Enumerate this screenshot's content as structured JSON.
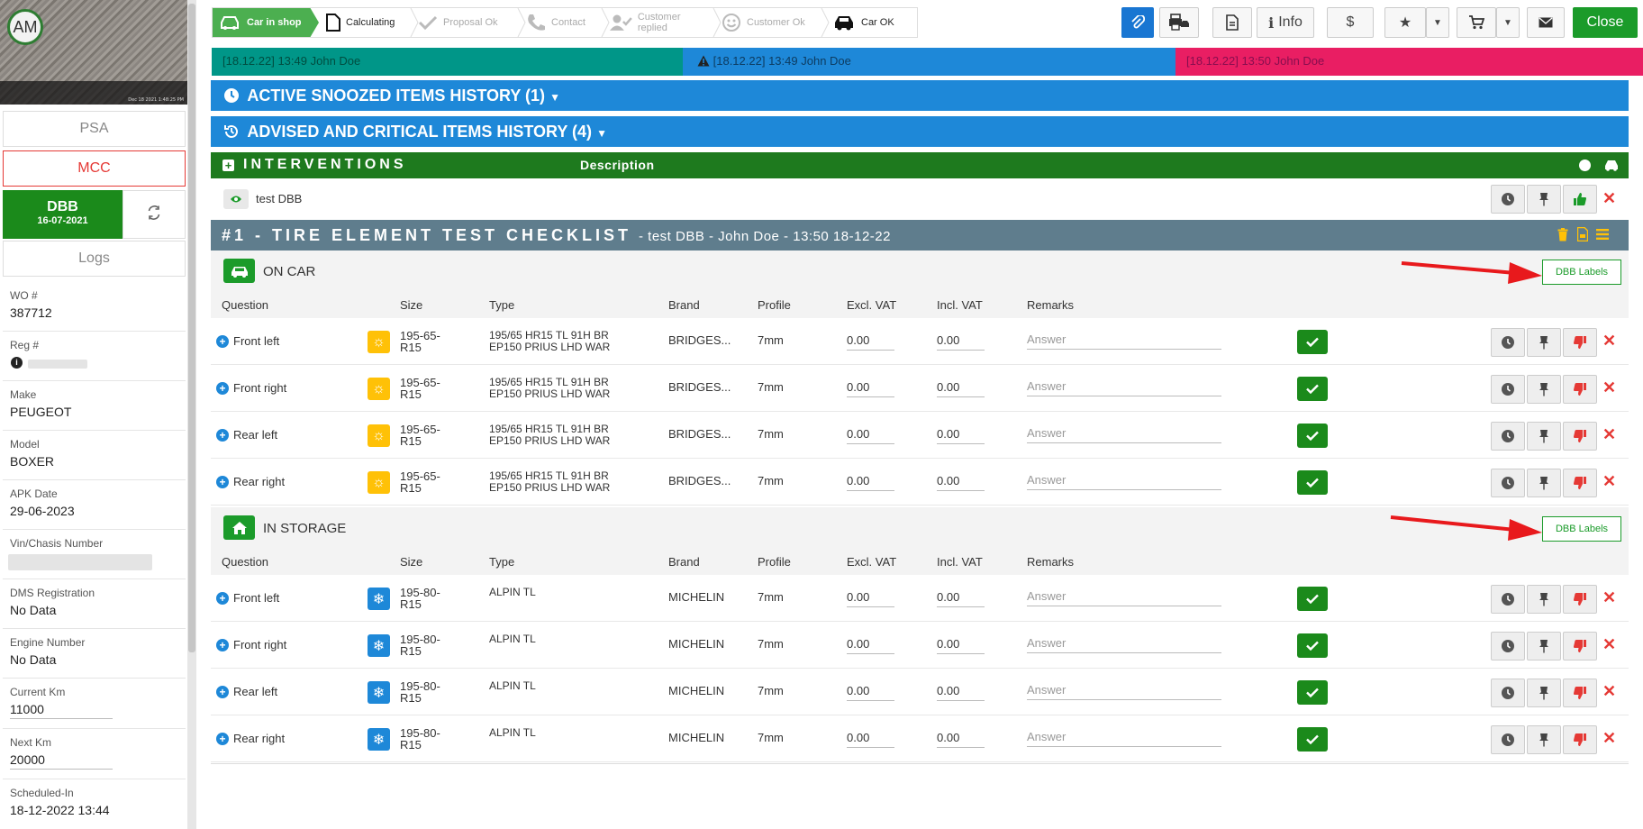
{
  "sidebar": {
    "avatar_initials": "AM",
    "photo_timestamp": "Dec 18 2021 1:48:25 PM",
    "psa_label": "PSA",
    "mcc_label": "MCC",
    "dbb_label": "DBB",
    "dbb_date": "16-07-2021",
    "logs_label": "Logs",
    "fields": [
      {
        "label": "WO #",
        "value": "387712"
      },
      {
        "label": "Reg #",
        "value": ""
      },
      {
        "label": "Make",
        "value": "PEUGEOT"
      },
      {
        "label": "Model",
        "value": "BOXER"
      },
      {
        "label": "APK Date",
        "value": "29-06-2023"
      },
      {
        "label": "Vin/Chasis Number",
        "value": ""
      },
      {
        "label": "DMS Registration",
        "value": "No Data"
      },
      {
        "label": "Engine Number",
        "value": "No Data"
      },
      {
        "label": "Current Km",
        "value": "11000"
      },
      {
        "label": "Next Km",
        "value": "20000"
      },
      {
        "label": "Scheduled-In",
        "value": "18-12-2022 13:44"
      }
    ]
  },
  "workflow": {
    "steps": [
      {
        "label": "Car in shop",
        "state": "active",
        "icon": "car-icon"
      },
      {
        "label": "Calculating",
        "state": "done",
        "icon": "document-icon"
      },
      {
        "label": "Proposal Ok",
        "state": "todo",
        "icon": "check-icon"
      },
      {
        "label": "Contact",
        "state": "todo",
        "icon": "phone-icon"
      },
      {
        "label": "Customer replied",
        "state": "todo",
        "icon": "user-check-icon"
      },
      {
        "label": "Customer Ok",
        "state": "todo",
        "icon": "smiley-icon"
      },
      {
        "label": "Car OK",
        "state": "done",
        "icon": "car-icon"
      }
    ]
  },
  "toolbar": {
    "info_label": "Info",
    "dollar_label": "$",
    "close_label": "Close"
  },
  "banners": [
    {
      "date": "[18.12.22] 13:49",
      "user": "John Doe",
      "color": "#009688"
    },
    {
      "date": "[18.12.22] 13:49",
      "user": "John Doe",
      "color": "#1e88d8"
    },
    {
      "date": "[18.12.22] 13:50",
      "user": "John Doe",
      "color": "#e91e63"
    }
  ],
  "sections": {
    "snoozed": "ACTIVE SNOOZED ITEMS HISTORY (1)",
    "advised": "ADVISED AND CRITICAL ITEMS HISTORY (4)"
  },
  "interventions": {
    "title": "INTERVENTIONS",
    "description_header": "Description",
    "item_label": "test DBB"
  },
  "checklist": {
    "title": "#1 - TIRE ELEMENT TEST CHECKLIST",
    "subtitle": "- test DBB - John Doe - 13:50 18-12-22",
    "dbb_labels_button": "DBB Labels",
    "columns": [
      "Question",
      "Size",
      "Type",
      "Brand",
      "Profile",
      "Excl. VAT",
      "Incl. VAT",
      "Remarks"
    ],
    "groups": [
      {
        "label": "ON CAR",
        "icon": "car-icon",
        "rows": [
          {
            "question": "Front left",
            "season": "summer",
            "size": "195-65-R15",
            "type": "195/65 HR15 TL 91H BR EP150 PRIUS LHD WAR",
            "brand": "BRIDGES...",
            "profile": "7mm",
            "excl": "0.00",
            "incl": "0.00",
            "remark": "Answer"
          },
          {
            "question": "Front right",
            "season": "summer",
            "size": "195-65-R15",
            "type": "195/65 HR15 TL 91H BR EP150 PRIUS LHD WAR",
            "brand": "BRIDGES...",
            "profile": "7mm",
            "excl": "0.00",
            "incl": "0.00",
            "remark": "Answer"
          },
          {
            "question": "Rear left",
            "season": "summer",
            "size": "195-65-R15",
            "type": "195/65 HR15 TL 91H BR EP150 PRIUS LHD WAR",
            "brand": "BRIDGES...",
            "profile": "7mm",
            "excl": "0.00",
            "incl": "0.00",
            "remark": "Answer"
          },
          {
            "question": "Rear right",
            "season": "summer",
            "size": "195-65-R15",
            "type": "195/65 HR15 TL 91H BR EP150 PRIUS LHD WAR",
            "brand": "BRIDGES...",
            "profile": "7mm",
            "excl": "0.00",
            "incl": "0.00",
            "remark": "Answer"
          }
        ]
      },
      {
        "label": "IN STORAGE",
        "icon": "home-icon",
        "rows": [
          {
            "question": "Front left",
            "season": "winter",
            "size": "195-80-R15",
            "type": "ALPIN TL",
            "brand": "MICHELIN",
            "profile": "7mm",
            "excl": "0.00",
            "incl": "0.00",
            "remark": "Answer"
          },
          {
            "question": "Front right",
            "season": "winter",
            "size": "195-80-R15",
            "type": "ALPIN TL",
            "brand": "MICHELIN",
            "profile": "7mm",
            "excl": "0.00",
            "incl": "0.00",
            "remark": "Answer"
          },
          {
            "question": "Rear left",
            "season": "winter",
            "size": "195-80-R15",
            "type": "ALPIN TL",
            "brand": "MICHELIN",
            "profile": "7mm",
            "excl": "0.00",
            "incl": "0.00",
            "remark": "Answer"
          },
          {
            "question": "Rear right",
            "season": "winter",
            "size": "195-80-R15",
            "type": "ALPIN TL",
            "brand": "MICHELIN",
            "profile": "7mm",
            "excl": "0.00",
            "incl": "0.00",
            "remark": "Answer"
          }
        ]
      }
    ]
  },
  "colors": {
    "green": "#1b9b2a",
    "blue": "#1e88d8",
    "red": "#e53935",
    "slate": "#5f7d8d",
    "annotation_arrow": "#e8191c"
  }
}
